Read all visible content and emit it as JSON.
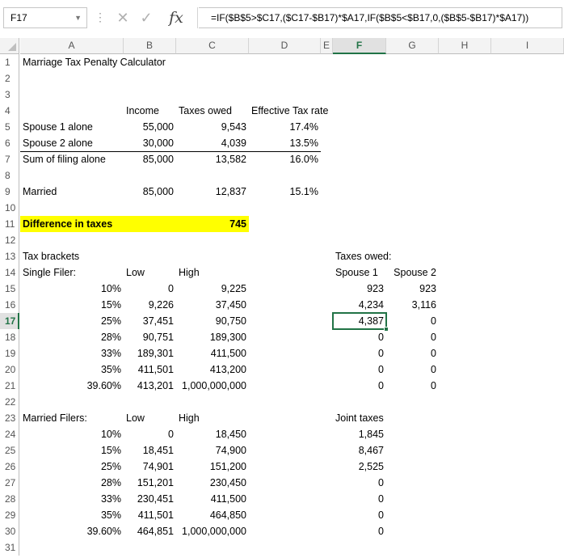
{
  "formula_bar": {
    "name_box": "F17",
    "cancel_icon": "✕",
    "enter_icon": "✓",
    "fx_label": "fx",
    "formula": "=IF($B$5>$C17,($C17-$B17)*$A17,IF($B$5<$B17,0,($B$5-$B17)*$A17))"
  },
  "columns": [
    "A",
    "B",
    "C",
    "D",
    "E",
    "F",
    "G",
    "H",
    "I"
  ],
  "selected_column": "F",
  "selected_row": "17",
  "rows": [
    "1",
    "2",
    "3",
    "4",
    "5",
    "6",
    "7",
    "8",
    "9",
    "10",
    "11",
    "12",
    "13",
    "14",
    "15",
    "16",
    "17",
    "18",
    "19",
    "20",
    "21",
    "22",
    "23",
    "24",
    "25",
    "26",
    "27",
    "28",
    "29",
    "30",
    "31"
  ],
  "cells": {
    "A1": "Marriage Tax Penalty Calculator",
    "B4": "Income",
    "C4": "Taxes owed",
    "D4": "Effective Tax rate",
    "A5": "Spouse 1 alone",
    "B5": "55,000",
    "C5": "9,543",
    "D5": "17.4%",
    "A6": "Spouse 2 alone",
    "B6": "30,000",
    "C6": "4,039",
    "D6": "13.5%",
    "A7": "Sum of filing alone",
    "B7": "85,000",
    "C7": "13,582",
    "D7": "16.0%",
    "A9": "Married",
    "B9": "85,000",
    "C9": "12,837",
    "D9": "15.1%",
    "A11": "Difference in taxes",
    "C11": "745",
    "A13": "Tax brackets",
    "F13": "Taxes owed:",
    "A14": "Single Filer:",
    "B14": "Low",
    "C14": "High",
    "F14": "Spouse 1",
    "G14": "Spouse 2",
    "A15": "10%",
    "B15": "0",
    "C15": "9,225",
    "F15": "923",
    "G15": "923",
    "A16": "15%",
    "B16": "9,226",
    "C16": "37,450",
    "F16": "4,234",
    "G16": "3,116",
    "A17": "25%",
    "B17": "37,451",
    "C17": "90,750",
    "F17": "4,387",
    "G17": "0",
    "A18": "28%",
    "B18": "90,751",
    "C18": "189,300",
    "F18": "0",
    "G18": "0",
    "A19": "33%",
    "B19": "189,301",
    "C19": "411,500",
    "F19": "0",
    "G19": "0",
    "A20": "35%",
    "B20": "411,501",
    "C20": "413,200",
    "F20": "0",
    "G20": "0",
    "A21": "39.60%",
    "B21": "413,201",
    "C21": "1,000,000,000",
    "F21": "0",
    "G21": "0",
    "A23": "Married Filers:",
    "B23": "Low",
    "C23": "High",
    "F23": "Joint taxes",
    "A24": "10%",
    "B24": "0",
    "C24": "18,450",
    "F24": "1,845",
    "A25": "15%",
    "B25": "18,451",
    "C25": "74,900",
    "F25": "8,467",
    "A26": "25%",
    "B26": "74,901",
    "C26": "151,200",
    "F26": "2,525",
    "A27": "28%",
    "B27": "151,201",
    "C27": "230,450",
    "F27": "0",
    "A28": "33%",
    "B28": "230,451",
    "C28": "411,500",
    "F28": "0",
    "A29": "35%",
    "B29": "411,501",
    "C29": "464,850",
    "F29": "0",
    "A30": "39.60%",
    "B30": "464,851",
    "C30": "1,000,000,000",
    "F30": "0"
  },
  "colors": {
    "accent": "#217346",
    "highlight": "#ffff00"
  }
}
